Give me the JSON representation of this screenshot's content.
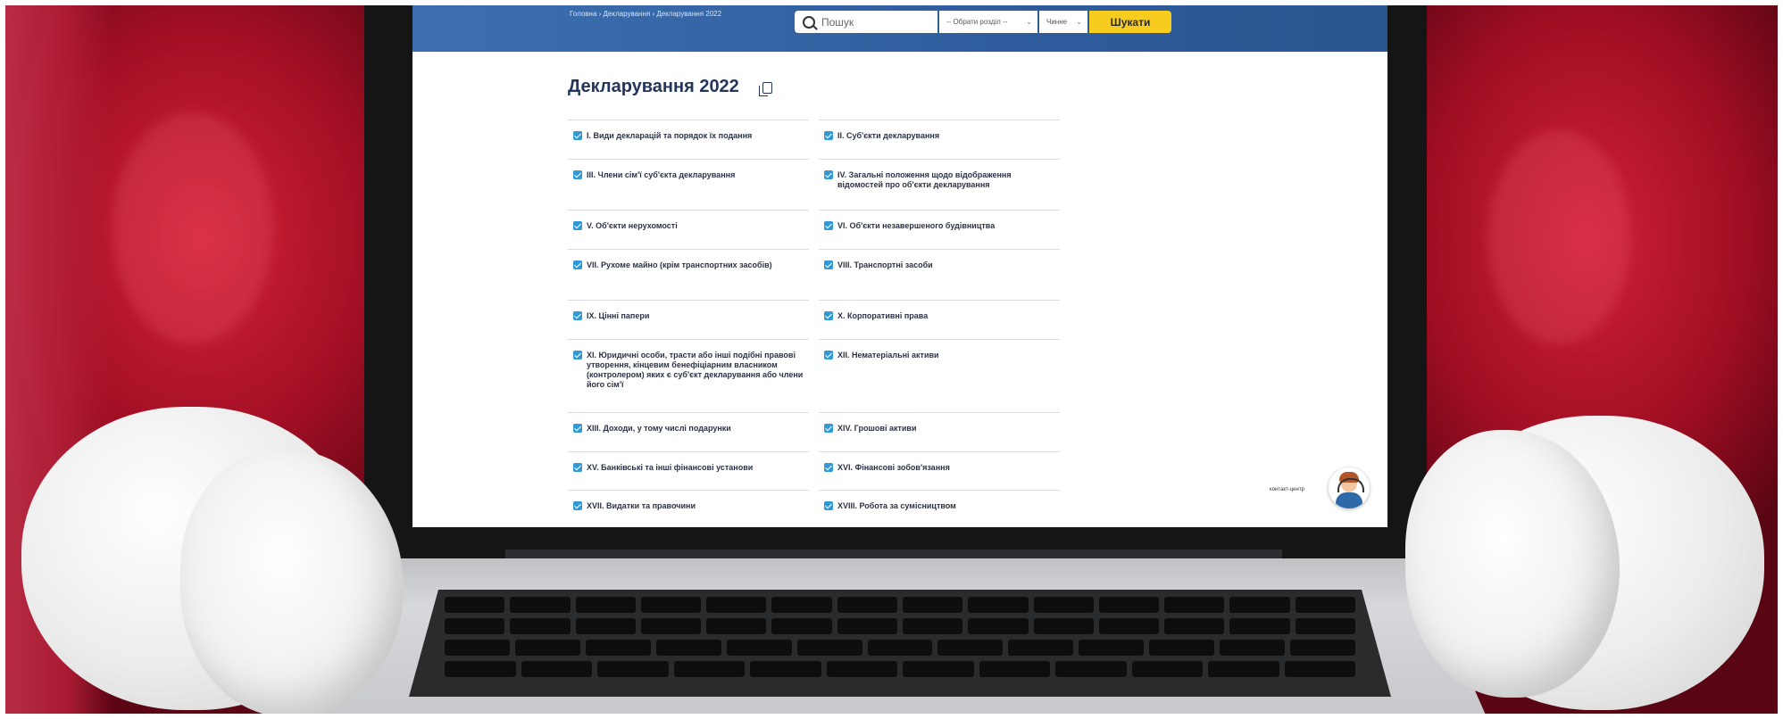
{
  "header": {
    "breadcrumb": "Головна › Декларування › Декларування 2022",
    "search_placeholder": "Пошук",
    "section_select": "-- Обрати розділ --",
    "status_select": "Чинне",
    "search_button": "Шукати"
  },
  "page": {
    "title": "Декларування 2022"
  },
  "sections": [
    "I. Види декларацій та порядок їх подання",
    "II. Суб'єкти декларування",
    "III. Члени сім'ї суб'єкта декларування",
    "IV. Загальні положення щодо відображення відомостей про об'єкти декларування",
    "V. Об'єкти нерухомості",
    "VI. Об'єкти незавершеного будівництва",
    "VII. Рухоме майно (крім транспортних засобів)",
    "VIII. Транспортні засоби",
    "IX. Цінні папери",
    "X. Корпоративні права",
    "XI. Юридичні особи, трасти або інші подібні правові утворення, кінцевим бенефіціарним власником (контролером) яких є суб'єкт декларування або члени його сім'ї",
    "XII. Нематеріальні активи",
    "XIII. Доходи, у тому числі подарунки",
    "XIV. Грошові активи",
    "XV. Банківські та інші фінансові установи",
    "XVI. Фінансові зобов'язання",
    "XVII. Видатки та правочини",
    "XVIII. Робота за сумісництвом"
  ],
  "contact": {
    "label": "контакт-центр"
  },
  "colors": {
    "header_blue": "#2f5d9c",
    "button_yellow": "#f6cd1f",
    "checkbox_blue": "#2f9ad6",
    "title_navy": "#23355a",
    "velvet_red": "#a30f24"
  }
}
